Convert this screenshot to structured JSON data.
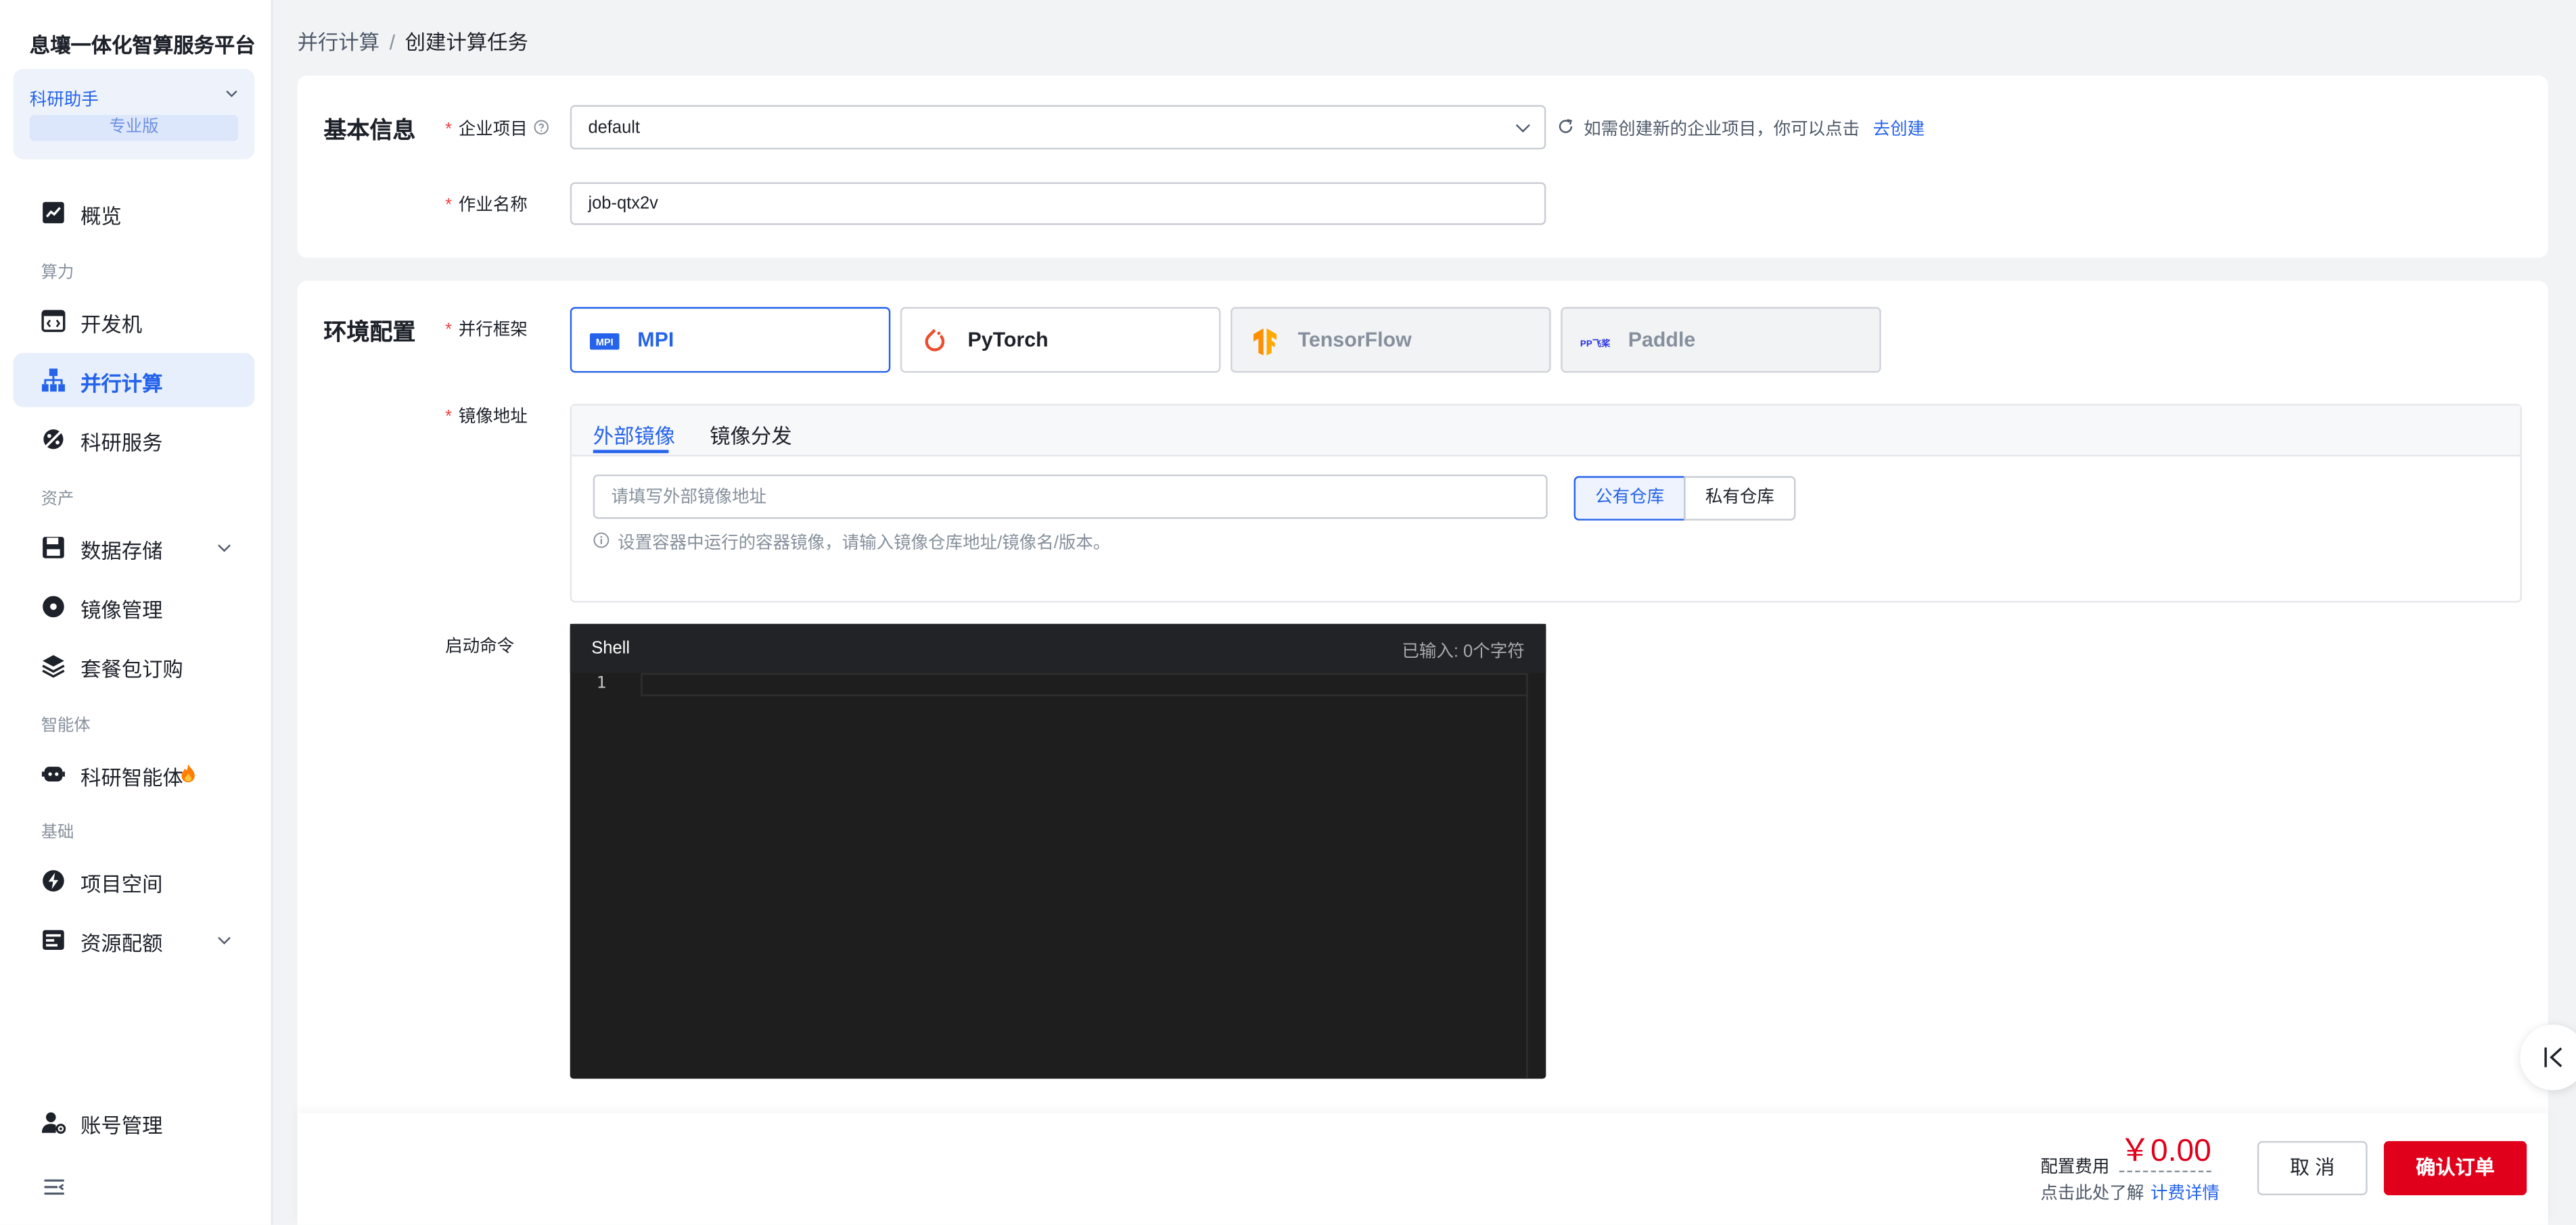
{
  "sidebar": {
    "brand": "息壤一体化智算服务平台",
    "workspace": {
      "name": "科研助手",
      "badge": "专业版"
    },
    "items": {
      "overview": "概览",
      "section_compute": "算力",
      "devbox": "开发机",
      "parallel": "并行计算",
      "research_service": "科研服务",
      "section_assets": "资产",
      "storage": "数据存储",
      "images": "镜像管理",
      "packages": "套餐包订购",
      "section_agent": "智能体",
      "agent": "科研智能体",
      "section_base": "基础",
      "projects": "项目空间",
      "quota": "资源配额",
      "account": "账号管理"
    }
  },
  "breadcrumb": {
    "parent": "并行计算",
    "separator": "/",
    "current": "创建计算任务"
  },
  "basic": {
    "title": "基本信息",
    "project_label": "企业项目",
    "project_value": "default",
    "create_hint": "如需创建新的企业项目，你可以点击",
    "create_link": "去创建",
    "job_label": "作业名称",
    "job_value": "job-qtx2v"
  },
  "env": {
    "title": "环境配置",
    "framework_label": "并行框架",
    "frameworks": {
      "mpi": "MPI",
      "pytorch": "PyTorch",
      "tensorflow": "TensorFlow",
      "paddle": "Paddle"
    },
    "mpi_badge": "MPI",
    "paddle_badge": "PP飞桨",
    "image_label": "镜像地址",
    "tabs": {
      "external": "外部镜像",
      "distribution": "镜像分发"
    },
    "image_placeholder": "请填写外部镜像地址",
    "repo": {
      "public": "公有仓库",
      "private": "私有仓库"
    },
    "image_hint": "设置容器中运行的容器镜像，请输入镜像仓库地址/镜像名/版本。",
    "cmd_label": "启动命令",
    "editor": {
      "lang": "Shell",
      "char_count": "已输入: 0个字符",
      "line_number": "1"
    }
  },
  "footer": {
    "fee_label": "配置费用",
    "fee_value": "￥0.00",
    "detail_prefix": "点击此处了解",
    "detail_link": "计费详情",
    "cancel": "取 消",
    "confirm": "确认订单"
  },
  "colors": {
    "accent": "#2563eb",
    "danger": "#e0001b",
    "editor_bg": "#1e1e1e"
  }
}
